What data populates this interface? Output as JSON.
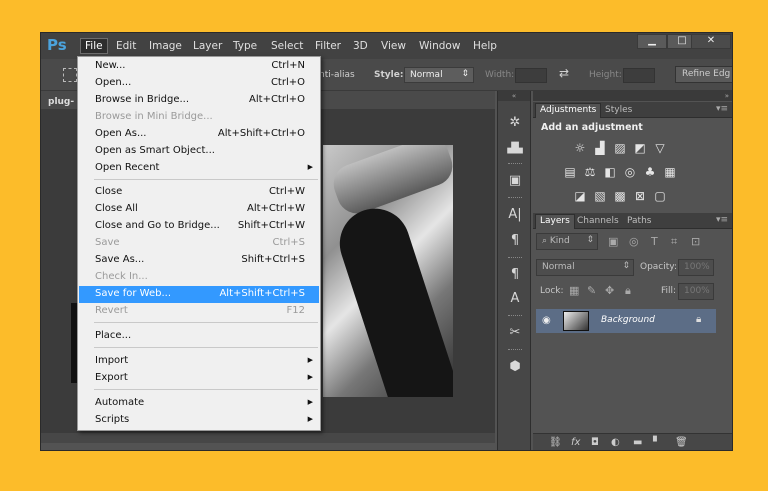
{
  "app": {
    "logo": "Ps"
  },
  "menubar": {
    "items": [
      "File",
      "Edit",
      "Image",
      "Layer",
      "Type",
      "Select",
      "Filter",
      "3D",
      "View",
      "Window",
      "Help"
    ],
    "window_buttons": {
      "minimize": "▁",
      "restore": "□",
      "close": "✕"
    }
  },
  "options": {
    "anti_alias": "nti-alias",
    "style_label": "Style:",
    "style_value": "Normal",
    "width_label": "Width:",
    "height_label": "Height:",
    "refine_button": "Refine Edg"
  },
  "document": {
    "tab_label": "plug-"
  },
  "file_menu": {
    "items": [
      {
        "label": "New...",
        "shortcut": "Ctrl+N"
      },
      {
        "label": "Open...",
        "shortcut": "Ctrl+O"
      },
      {
        "label": "Browse in Bridge...",
        "shortcut": "Alt+Ctrl+O"
      },
      {
        "label": "Browse in Mini Bridge...",
        "shortcut": ""
      },
      {
        "label": "Open As...",
        "shortcut": "Alt+Shift+Ctrl+O"
      },
      {
        "label": "Open as Smart Object...",
        "shortcut": ""
      },
      {
        "label": "Open Recent",
        "shortcut": ""
      },
      {
        "label": "Close",
        "shortcut": "Ctrl+W"
      },
      {
        "label": "Close All",
        "shortcut": "Alt+Ctrl+W"
      },
      {
        "label": "Close and Go to Bridge...",
        "shortcut": "Shift+Ctrl+W"
      },
      {
        "label": "Save",
        "shortcut": "Ctrl+S"
      },
      {
        "label": "Save As...",
        "shortcut": "Shift+Ctrl+S"
      },
      {
        "label": "Check In...",
        "shortcut": ""
      },
      {
        "label": "Save for Web...",
        "shortcut": "Alt+Shift+Ctrl+S"
      },
      {
        "label": "Revert",
        "shortcut": "F12"
      },
      {
        "label": "Place...",
        "shortcut": ""
      },
      {
        "label": "Import",
        "shortcut": ""
      },
      {
        "label": "Export",
        "shortcut": ""
      },
      {
        "label": "Automate",
        "shortcut": ""
      },
      {
        "label": "Scripts",
        "shortcut": ""
      }
    ]
  },
  "adjustments_panel": {
    "tabs": [
      "Adjustments",
      "Styles"
    ],
    "title": "Add an adjustment"
  },
  "layers_panel": {
    "tabs": [
      "Layers",
      "Channels",
      "Paths"
    ],
    "kind_filter": "Kind",
    "blend_mode": "Normal",
    "opacity_label": "Opacity:",
    "opacity_value": "100%",
    "lock_label": "Lock:",
    "fill_label": "Fill:",
    "fill_value": "100%",
    "layer_name": "Background"
  },
  "colors": {
    "highlight": "#3399ff",
    "background": "#fcbc2a",
    "layer_selected": "#5c6d86"
  }
}
